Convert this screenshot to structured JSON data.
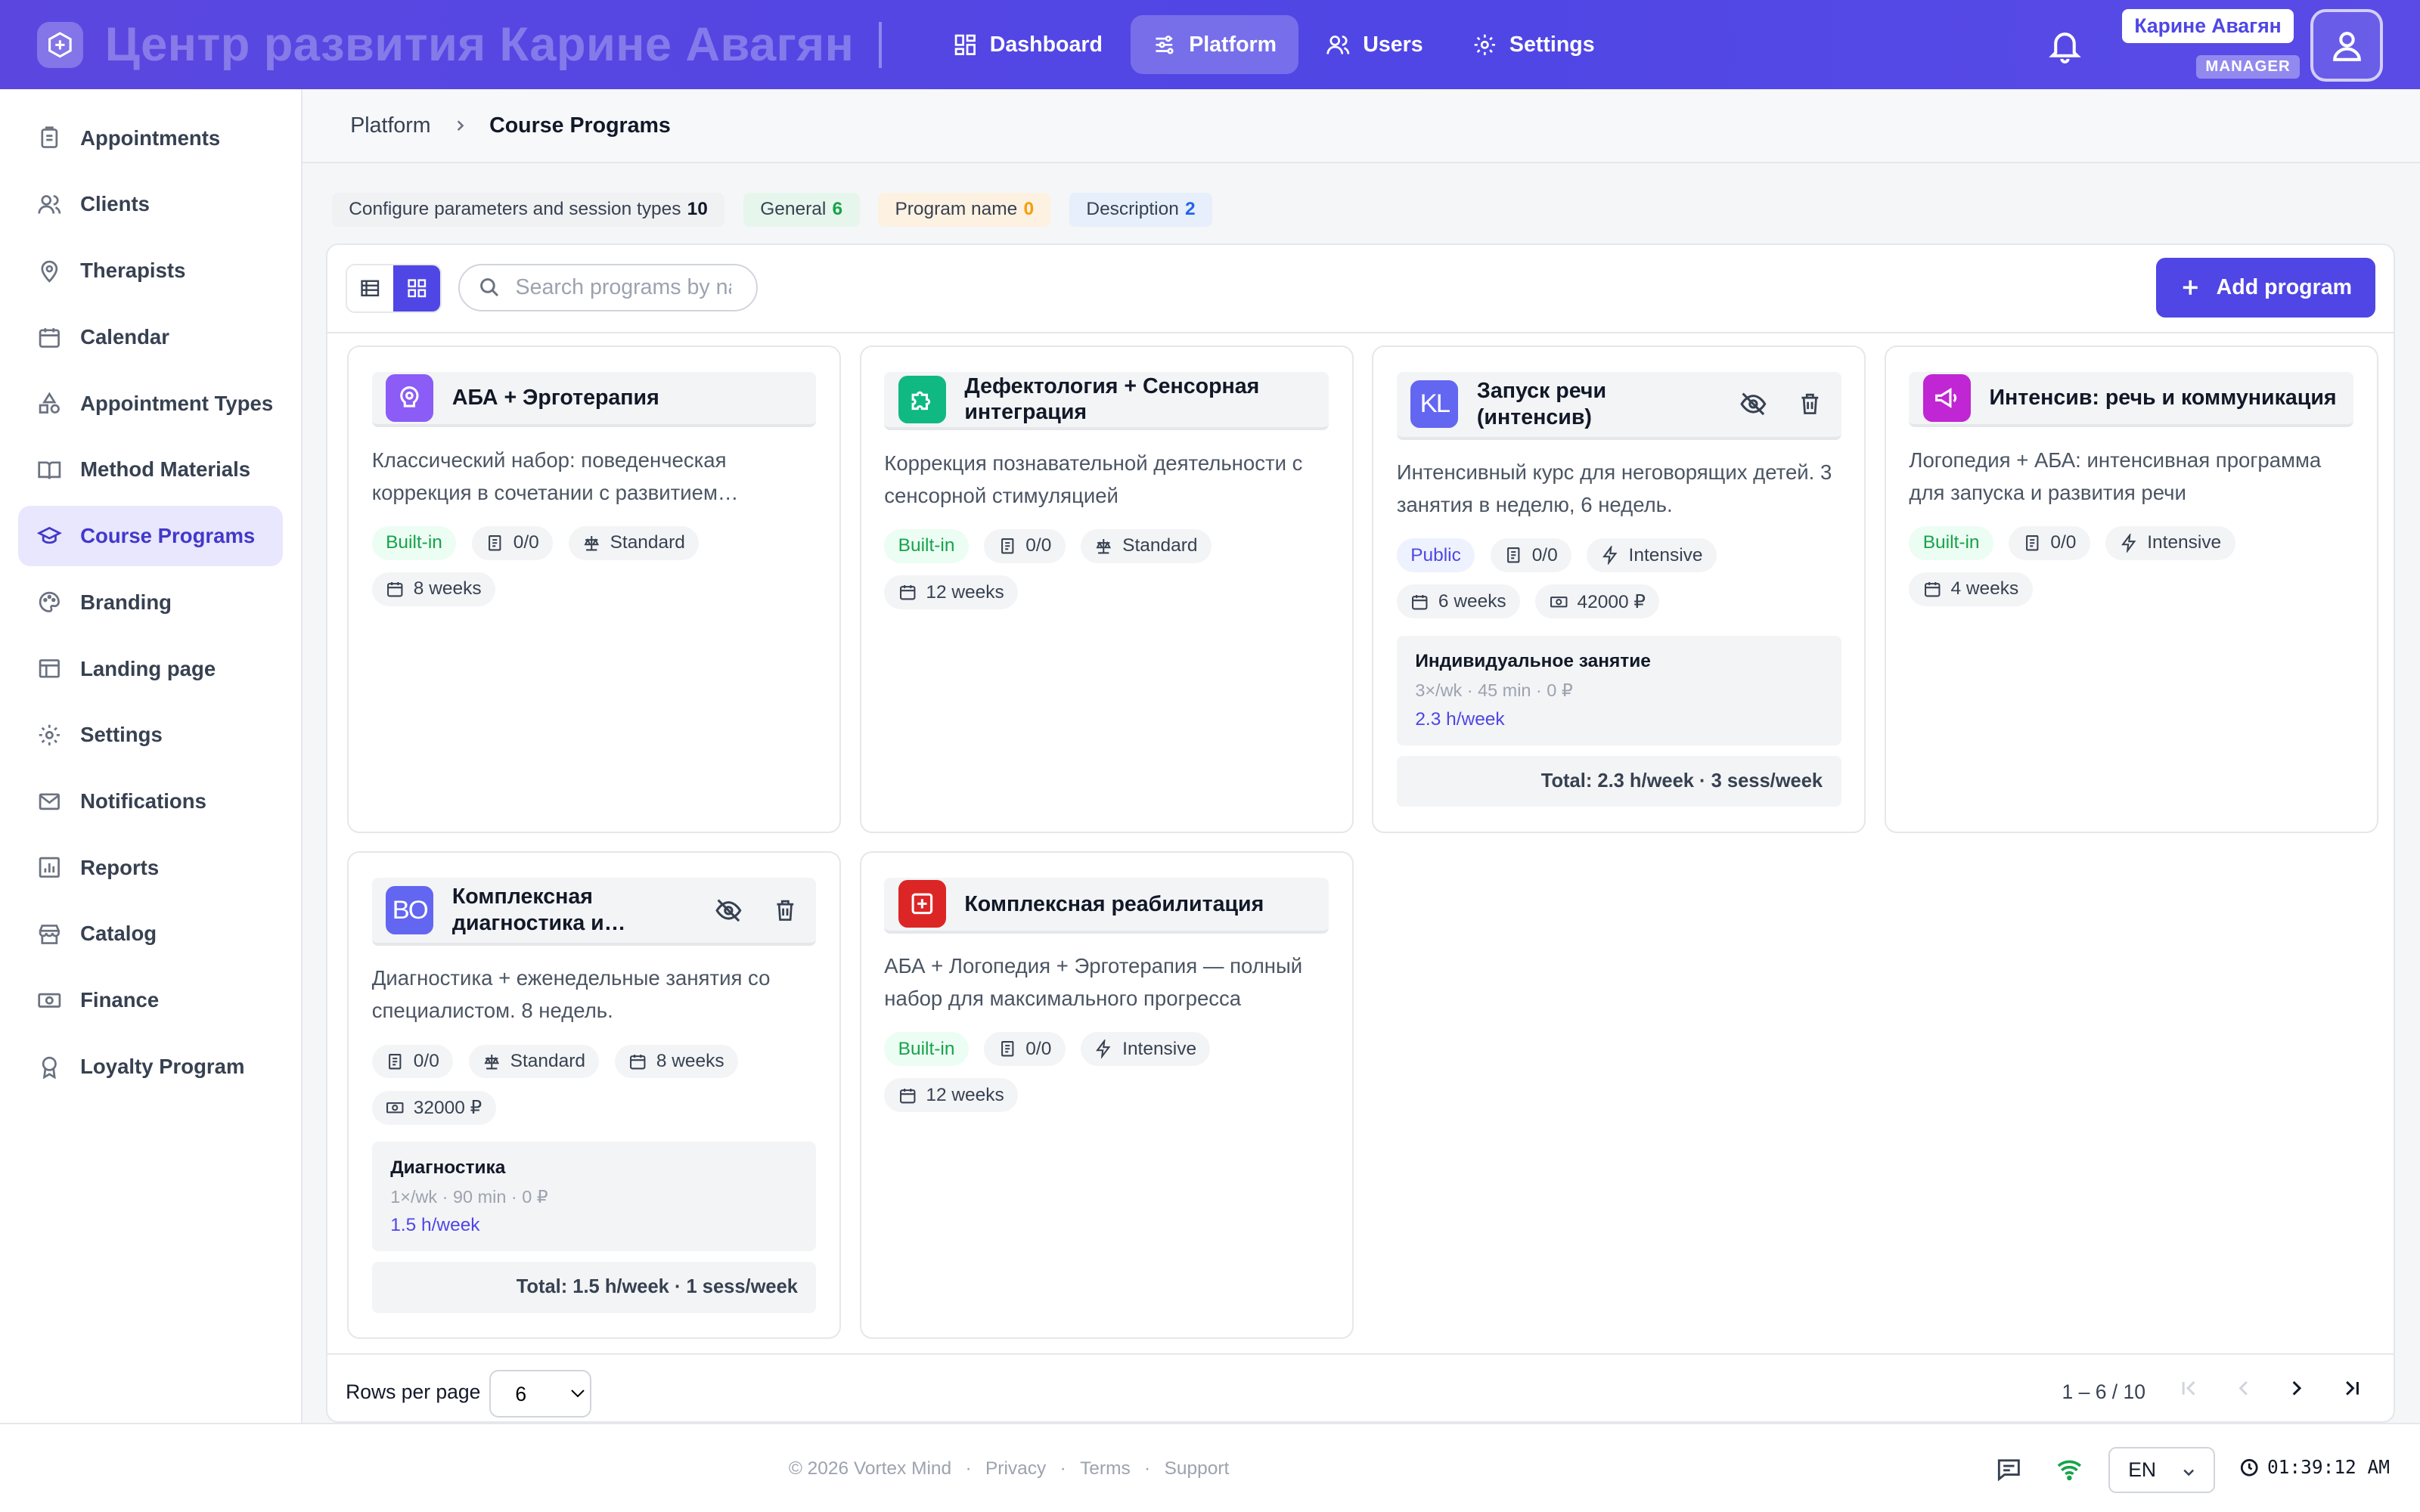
{
  "app": {
    "brand": "Центр развития Карине Авагян",
    "user_name": "Карине Авагян",
    "user_role": "MANAGER"
  },
  "topnav": [
    {
      "label": "Dashboard",
      "icon": "dashboard-icon"
    },
    {
      "label": "Platform",
      "icon": "sliders-icon",
      "active": true
    },
    {
      "label": "Users",
      "icon": "users-icon"
    },
    {
      "label": "Settings",
      "icon": "gear-icon"
    }
  ],
  "sidebar": {
    "items": [
      {
        "label": "Appointments",
        "icon": "clipboard-icon"
      },
      {
        "label": "Clients",
        "icon": "users-icon"
      },
      {
        "label": "Therapists",
        "icon": "location-icon"
      },
      {
        "label": "Calendar",
        "icon": "calendar-icon"
      },
      {
        "label": "Appointment Types",
        "icon": "shapes-icon"
      },
      {
        "label": "Method Materials",
        "icon": "book-icon"
      },
      {
        "label": "Course Programs",
        "icon": "graduation-cap-icon",
        "active": true
      },
      {
        "label": "Branding",
        "icon": "palette-icon"
      },
      {
        "label": "Landing page",
        "icon": "layout-icon"
      },
      {
        "label": "Settings",
        "icon": "gear-icon"
      },
      {
        "label": "Notifications",
        "icon": "mail-icon"
      },
      {
        "label": "Reports",
        "icon": "chart-icon"
      },
      {
        "label": "Catalog",
        "icon": "store-icon"
      },
      {
        "label": "Finance",
        "icon": "banknote-icon"
      },
      {
        "label": "Loyalty Program",
        "icon": "badge-icon"
      }
    ]
  },
  "breadcrumb": {
    "parent": "Platform",
    "current": "Course Programs"
  },
  "chips": [
    {
      "label": "Configure parameters and session types",
      "count": "10",
      "bg": "#f0f1f3",
      "countColor": "#111827"
    },
    {
      "label": "General",
      "count": "6",
      "bg": "#e7f6ec",
      "countColor": "#16a34a"
    },
    {
      "label": "Program name",
      "count": "0",
      "bg": "#fdf1e1",
      "countColor": "#f59e0b"
    },
    {
      "label": "Description",
      "count": "2",
      "bg": "#e6effb",
      "countColor": "#2563eb"
    }
  ],
  "toolbar": {
    "search_placeholder": "Search programs by name",
    "add_label": "Add program"
  },
  "cards": [
    {
      "title": "АБА + Эрготерапия",
      "description": "Классический набор: поведенческая коррекция в сочетании с развитием…",
      "tags": [
        "Built-in",
        "0/0",
        "Standard",
        "8 weeks"
      ]
    },
    {
      "title": "Дефектология + Сенсорная интеграция",
      "description": "Коррекция познавательной деятельности с сенсорной стимуляцией",
      "tags": [
        "Built-in",
        "0/0",
        "Standard",
        "12 weeks"
      ]
    },
    {
      "title": "Запуск речи (интенсив)",
      "description": "Интенсивный курс для неговорящих детей. 3 занятия в неделю, 6 недель.",
      "tags": [
        "Public",
        "0/0",
        "Intensive",
        "6 weeks",
        "42000 ₽"
      ],
      "session": {
        "name": "Индивидуальное занятие",
        "meta": "3×/wk · 45 min · 0 ₽",
        "hours": "2.3 h/week"
      },
      "total": "Total: 2.3 h/week · 3 sess/week",
      "icon_text": "KL"
    },
    {
      "title": "Интенсив: речь и коммуникация",
      "description": "Логопедия + АБА: интенсивная программа для запуска и развития речи",
      "tags": [
        "Built-in",
        "0/0",
        "Intensive",
        "4 weeks"
      ]
    },
    {
      "title": "Комплексная диагностика и…",
      "description": "Диагностика + еженедельные занятия со специалистом. 8 недель.",
      "tags": [
        "0/0",
        "Standard",
        "8 weeks",
        "32000 ₽"
      ],
      "session": {
        "name": "Диагностика",
        "meta": "1×/wk · 90 min · 0 ₽",
        "hours": "1.5 h/week"
      },
      "total": "Total: 1.5 h/week · 1 sess/week",
      "icon_text": "BO"
    },
    {
      "title": "Комплексная реабилитация",
      "description": "АБА + Логопедия + Эрготерапия — полный набор для максимального прогресса",
      "tags": [
        "Built-in",
        "0/0",
        "Intensive",
        "12 weeks"
      ]
    }
  ],
  "pager": {
    "rows_label": "Rows per page",
    "rows_value": "6",
    "range": "1 – 6 / 10"
  },
  "footer": {
    "copyright": "© 2026 Vortex Mind",
    "links": [
      "Privacy",
      "Terms",
      "Support"
    ],
    "lang": "EN",
    "time": "01:39:12 AM"
  },
  "colors": {
    "accent": "#4f46e5",
    "built_in": "#16a34a"
  }
}
